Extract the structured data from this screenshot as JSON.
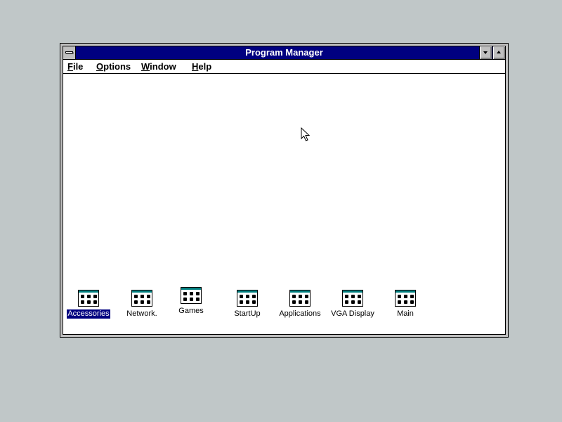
{
  "window": {
    "title": "Program Manager"
  },
  "menu": [
    {
      "accel": "F",
      "rest": "ile"
    },
    {
      "accel": "O",
      "rest": "ptions"
    },
    {
      "accel": "W",
      "rest": "indow"
    },
    {
      "accel": "H",
      "rest": "elp"
    }
  ],
  "groups": [
    {
      "label": "Accessories",
      "selected": true
    },
    {
      "label": "Network."
    },
    {
      "label": "Games"
    },
    {
      "label": "StartUp"
    },
    {
      "label": "Applications"
    },
    {
      "label": "VGA Display"
    },
    {
      "label": "Main"
    }
  ],
  "colors": {
    "desktop": "#c0c7c8",
    "title_active": "#000080",
    "selection": "#000080",
    "group_accent": "#008080"
  },
  "icons": {
    "system_menu": "system-menu-icon",
    "minimize": "minimize-arrow-icon",
    "maximize": "maximize-arrow-icon",
    "group": "program-group-icon",
    "cursor": "mouse-pointer-icon"
  }
}
